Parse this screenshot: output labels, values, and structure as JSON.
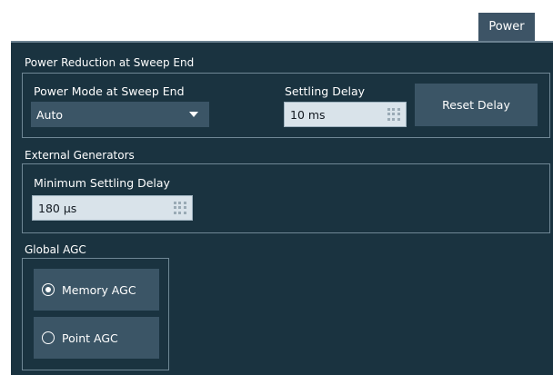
{
  "tab": {
    "label": "Power"
  },
  "power_reduction": {
    "title": "Power Reduction at Sweep End",
    "power_mode_label": "Power Mode at Sweep End",
    "power_mode_value": "Auto",
    "settling_delay_label": "Settling Delay",
    "settling_delay_value": "10 ms",
    "reset_delay_label": "Reset Delay"
  },
  "external_generators": {
    "title": "External Generators",
    "min_settling_label": "Minimum Settling Delay",
    "min_settling_value": "180 µs"
  },
  "global_agc": {
    "title": "Global AGC",
    "options": [
      {
        "label": "Memory AGC",
        "selected": true
      },
      {
        "label": "Point AGC",
        "selected": false
      }
    ]
  },
  "colors": {
    "panel_bg": "#1a3340",
    "control_bg": "#3b5566",
    "field_bg": "#d9e3ea",
    "frame": "#6f8795"
  }
}
